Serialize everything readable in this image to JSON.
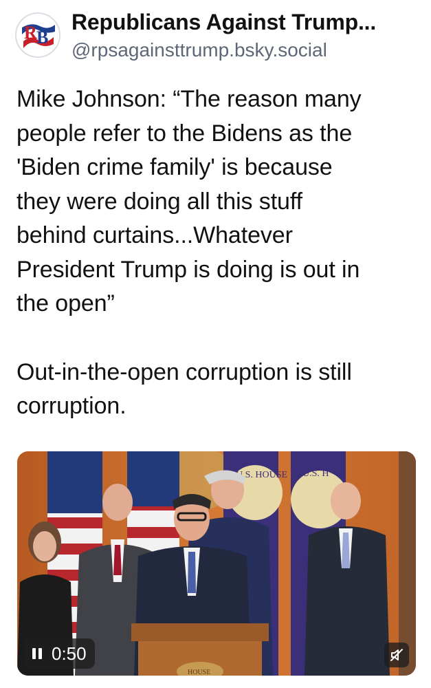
{
  "author": {
    "display_name": "Republicans Against Trump...",
    "handle": "@rpsagainsttrump.bsky.social",
    "avatar_letters": "RB"
  },
  "post": {
    "quote": "Mike Johnson: “The reason many\npeople refer to the Bidens as the\n'Biden crime family' is because\nthey were doing all this stuff\nbehind curtains...Whatever\nPresident Trump is doing is out in\nthe open”",
    "comment": "Out-in-the-open corruption is still\ncorruption."
  },
  "video": {
    "time": "0:50",
    "state": "playing",
    "muted": true,
    "pause_icon": "pause-icon",
    "mute_icon": "speaker-muted-icon",
    "backdrop_seal_text_left": "U.S. HOUSE",
    "backdrop_seal_text_right": "U.S. H",
    "podium_text": "HOUSE"
  },
  "colors": {
    "text": "#111111",
    "handle": "#5d6776",
    "overlay": "#1e1e1e"
  }
}
